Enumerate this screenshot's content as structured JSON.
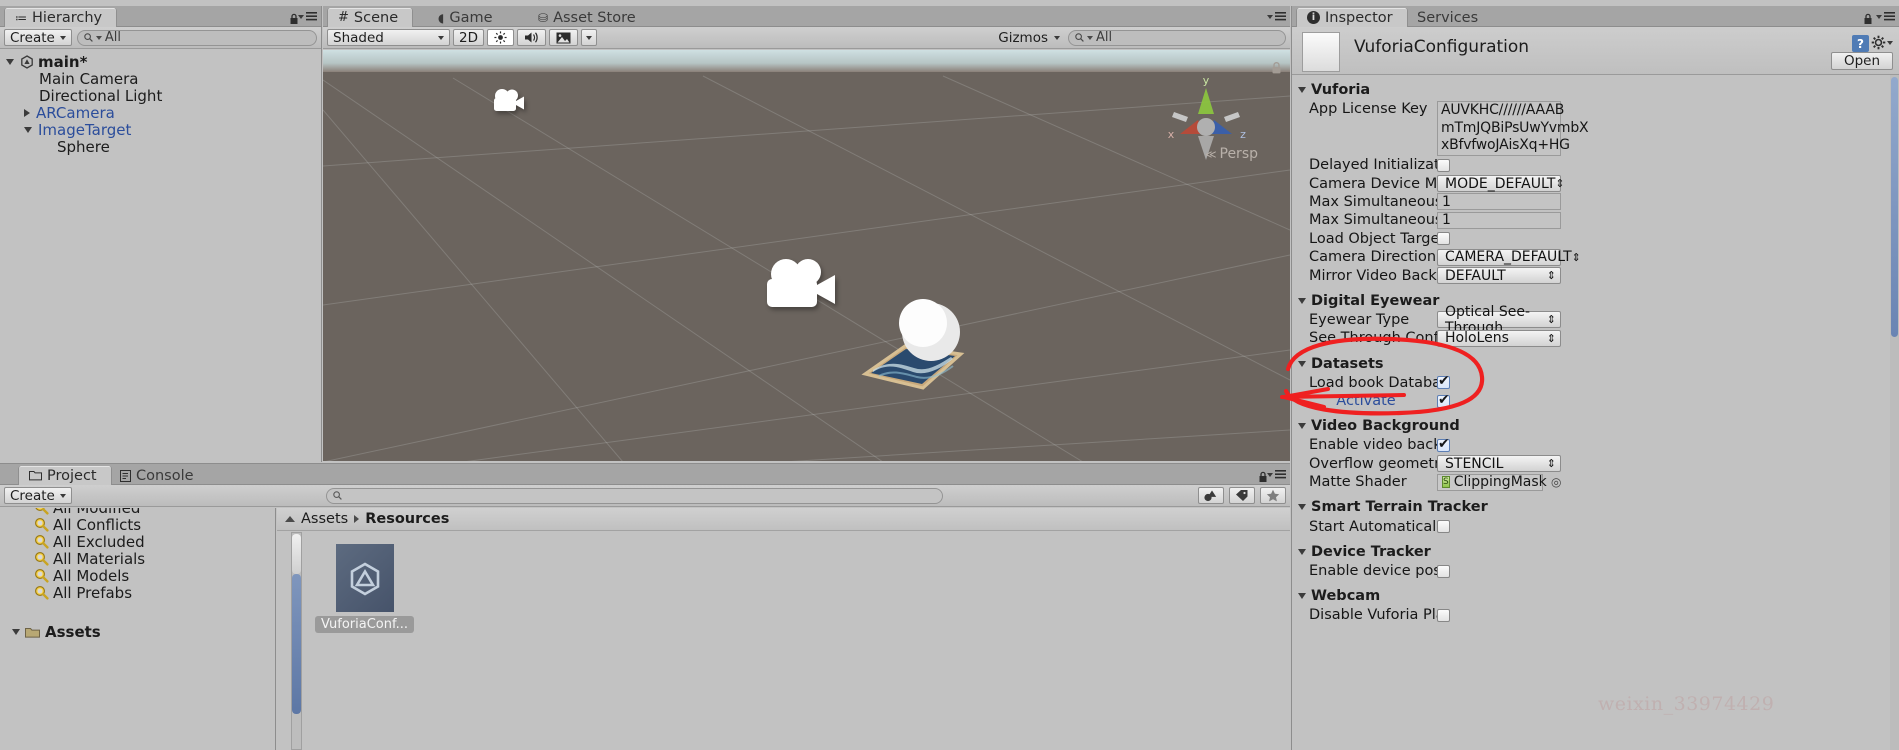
{
  "hierarchy": {
    "tab": "Hierarchy",
    "create_label": "Create",
    "search_placeholder": "All",
    "items": [
      {
        "label": "main*",
        "indent": 0,
        "arrow": "down",
        "bold": true,
        "blue": false,
        "icon": "unity-scene-icon"
      },
      {
        "label": "Main Camera",
        "indent": 1,
        "arrow": "none",
        "bold": false,
        "blue": false,
        "icon": ""
      },
      {
        "label": "Directional Light",
        "indent": 1,
        "arrow": "none",
        "bold": false,
        "blue": false,
        "icon": ""
      },
      {
        "label": "ARCamera",
        "indent": 1,
        "arrow": "right",
        "bold": false,
        "blue": true,
        "icon": ""
      },
      {
        "label": "ImageTarget",
        "indent": 1,
        "arrow": "down",
        "bold": false,
        "blue": true,
        "icon": ""
      },
      {
        "label": "Sphere",
        "indent": 2,
        "arrow": "none",
        "bold": false,
        "blue": false,
        "icon": ""
      }
    ]
  },
  "scene": {
    "tabs": [
      {
        "label": "Scene",
        "active": true,
        "icon": "grid-icon"
      },
      {
        "label": "Game",
        "active": false,
        "icon": "gamepad-icon"
      },
      {
        "label": "Asset Store",
        "active": false,
        "icon": "bag-icon"
      }
    ],
    "draw_mode": "Shaded",
    "mode_2d": "2D",
    "gizmos_label": "Gizmos",
    "gizmos_search_placeholder": "All",
    "persp_label": "Persp",
    "axis_x": "x",
    "axis_y": "y",
    "axis_z": "z"
  },
  "project": {
    "tabs": [
      {
        "label": "Project",
        "active": true,
        "icon": "folder-icon"
      },
      {
        "label": "Console",
        "active": false,
        "icon": "console-icon"
      }
    ],
    "create_label": "Create",
    "search_placeholder": "",
    "tree": [
      {
        "label": "All Modified",
        "icon": "search-favorite-icon"
      },
      {
        "label": "All Conflicts",
        "icon": "search-favorite-icon"
      },
      {
        "label": "All Excluded",
        "icon": "search-favorite-icon"
      },
      {
        "label": "All Materials",
        "icon": "search-favorite-icon"
      },
      {
        "label": "All Models",
        "icon": "search-favorite-icon"
      },
      {
        "label": "All Prefabs",
        "icon": "search-favorite-icon"
      }
    ],
    "assets_label": "Assets",
    "breadcrumb": [
      "Assets",
      "Resources"
    ],
    "items": [
      {
        "label": "VuforiaConf...",
        "icon": "unity-asset-icon"
      }
    ]
  },
  "inspector": {
    "tabs": [
      {
        "label": "Inspector",
        "active": true,
        "icon": "info-icon"
      },
      {
        "label": "Services",
        "active": false,
        "icon": ""
      }
    ],
    "asset_title": "VuforiaConfiguration",
    "open_button": "Open",
    "sections": [
      {
        "title": "Vuforia",
        "rows": [
          {
            "type": "licensekey",
            "label": "App License Key",
            "value": "AUVKHC//////AAABmTmJQBiPsUwYvmbXxBfvfwoJAisXq+HG"
          },
          {
            "type": "checkbox",
            "label": "Delayed Initialization",
            "checked": false
          },
          {
            "type": "dropdown",
            "label": "Camera Device Mod",
            "value": "MODE_DEFAULT"
          },
          {
            "type": "text",
            "label": "Max Simultaneous T",
            "value": "1"
          },
          {
            "type": "text",
            "label": "Max Simultaneous T",
            "value": "1"
          },
          {
            "type": "checkbox",
            "label": "Load Object Targets",
            "checked": false
          },
          {
            "type": "dropdown",
            "label": "Camera Direction",
            "value": "CAMERA_DEFAULT"
          },
          {
            "type": "dropdown",
            "label": "Mirror Video Backgro",
            "value": "DEFAULT"
          }
        ]
      },
      {
        "title": "Digital Eyewear",
        "rows": [
          {
            "type": "dropdown",
            "label": "Eyewear Type",
            "value": "Optical See-Through"
          },
          {
            "type": "dropdown",
            "label": "See Through Config",
            "value": "HoloLens"
          }
        ]
      },
      {
        "title": "Datasets",
        "rows": [
          {
            "type": "checkbox",
            "label": "Load book Database",
            "checked": true
          },
          {
            "type": "checkbox-link",
            "label": "Activate",
            "checked": true
          }
        ]
      },
      {
        "title": "Video Background",
        "rows": [
          {
            "type": "checkbox",
            "label": "Enable video backgr",
            "checked": true
          },
          {
            "type": "dropdown",
            "label": "Overflow geometry",
            "value": "STENCIL"
          },
          {
            "type": "object",
            "label": "Matte Shader",
            "value": "ClippingMask"
          }
        ]
      },
      {
        "title": "Smart Terrain Tracker",
        "rows": [
          {
            "type": "checkbox",
            "label": "Start Automatically",
            "checked": false
          }
        ]
      },
      {
        "title": "Device Tracker",
        "rows": [
          {
            "type": "checkbox",
            "label": "Enable device pose t",
            "checked": false
          }
        ]
      },
      {
        "title": "Webcam",
        "rows": [
          {
            "type": "checkbox",
            "label": "Disable Vuforia Play",
            "checked": false
          }
        ]
      }
    ]
  },
  "annotation": {
    "shape": "red-circle-arrow",
    "color": "#ef2020"
  },
  "watermark": "weixin_33974429"
}
